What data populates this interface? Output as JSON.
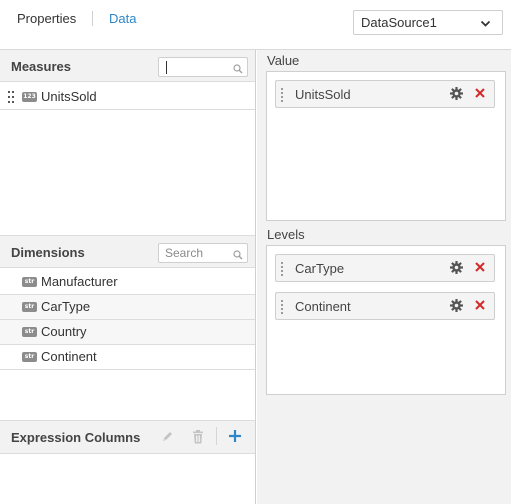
{
  "tabs": {
    "properties": "Properties",
    "data": "Data"
  },
  "datasource": {
    "selected": "DataSource1"
  },
  "measures": {
    "title": "Measures",
    "search_placeholder": "",
    "items": [
      {
        "label": "UnitsSold",
        "type_badge": "123"
      }
    ]
  },
  "dimensions": {
    "title": "Dimensions",
    "search_placeholder": "Search",
    "items": [
      {
        "label": "Manufacturer",
        "type_badge": "str"
      },
      {
        "label": "CarType",
        "type_badge": "str"
      },
      {
        "label": "Country",
        "type_badge": "str"
      },
      {
        "label": "Continent",
        "type_badge": "str"
      }
    ]
  },
  "expression_columns": {
    "title": "Expression Columns"
  },
  "value_zone": {
    "title": "Value",
    "items": [
      {
        "label": "UnitsSold"
      }
    ]
  },
  "levels_zone": {
    "title": "Levels",
    "items": [
      {
        "label": "CarType"
      },
      {
        "label": "Continent"
      }
    ]
  },
  "colors": {
    "accent": "#2e86c8",
    "remove": "#d22a2a",
    "header_bg": "#f2f2f2",
    "badge": "#8c8c8c"
  },
  "icons": {
    "dropdown": "chevron-down-icon",
    "search": "search-icon",
    "settings": "gear-icon",
    "remove": "close-icon",
    "edit": "pencil-icon",
    "delete": "trash-icon",
    "add": "plus-icon",
    "drag": "drag-handle-icon"
  }
}
